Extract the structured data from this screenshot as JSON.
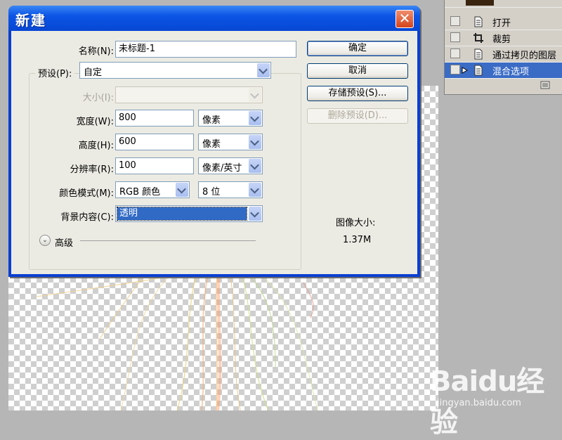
{
  "history": {
    "items": [
      {
        "label": "打开",
        "icon": "document-icon"
      },
      {
        "label": "裁剪",
        "icon": "crop-icon"
      },
      {
        "label": "通过拷贝的图层",
        "icon": "document-icon"
      },
      {
        "label": "混合选项",
        "icon": "document-icon",
        "selected": true
      }
    ]
  },
  "dialog": {
    "title": "新建",
    "close_glyph": "✕",
    "name_label": "名称(N):",
    "name_value": "未标题-1",
    "preset_label": "预设(P):",
    "preset_value": "自定",
    "size_label": "大小(I):",
    "width_label": "宽度(W):",
    "width_value": "800",
    "width_unit": "像素",
    "height_label": "高度(H):",
    "height_value": "600",
    "height_unit": "像素",
    "resolution_label": "分辨率(R):",
    "resolution_value": "100",
    "resolution_unit": "像素/英寸",
    "colormode_label": "颜色模式(M):",
    "colormode_value": "RGB 颜色",
    "bitdepth_value": "8 位",
    "background_label": "背景内容(C):",
    "background_value": "透明",
    "advanced_label": "高级",
    "buttons": {
      "ok": "确定",
      "cancel": "取消",
      "save_preset": "存储预设(S)...",
      "delete_preset": "删除预设(D)..."
    },
    "image_size_label": "图像大小:",
    "image_size_value": "1.37M"
  },
  "watermark": {
    "logo": "Baidu经验",
    "url": "jingyan.baidu.com"
  },
  "colors": {
    "title_bar": "#0c55e6",
    "selection": "#316ac5",
    "dialog_face": "#ecebe3"
  }
}
